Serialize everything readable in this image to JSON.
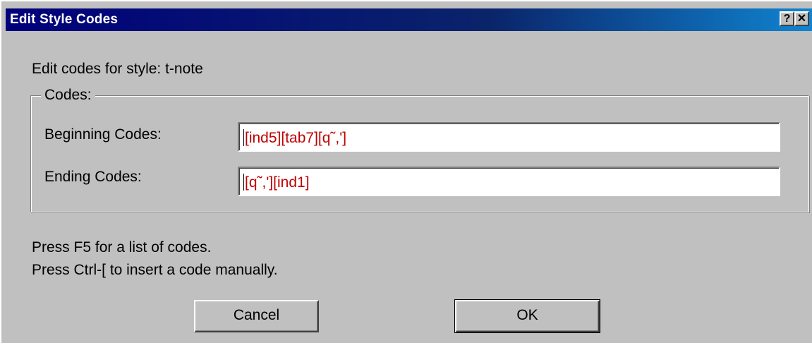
{
  "window": {
    "title": "Edit Style Codes",
    "help_button": "?",
    "close_button": "✕"
  },
  "prompt": "Edit codes for style: t-note",
  "group": {
    "label": "Codes:",
    "beginning": {
      "label": "Beginning Codes:",
      "value": "[ind5][tab7][q˜,']"
    },
    "ending": {
      "label": "Ending Codes:",
      "value": "[q˜,'][ind1]"
    }
  },
  "help": {
    "line1": "Press F5 for a list of codes.",
    "line2": "Press Ctrl-[ to insert a code manually."
  },
  "buttons": {
    "cancel": "Cancel",
    "ok": "OK"
  },
  "colors": {
    "titlebar": "#0a246a",
    "dialog_bg": "#c0c0c0",
    "code_text": "#c00000"
  }
}
